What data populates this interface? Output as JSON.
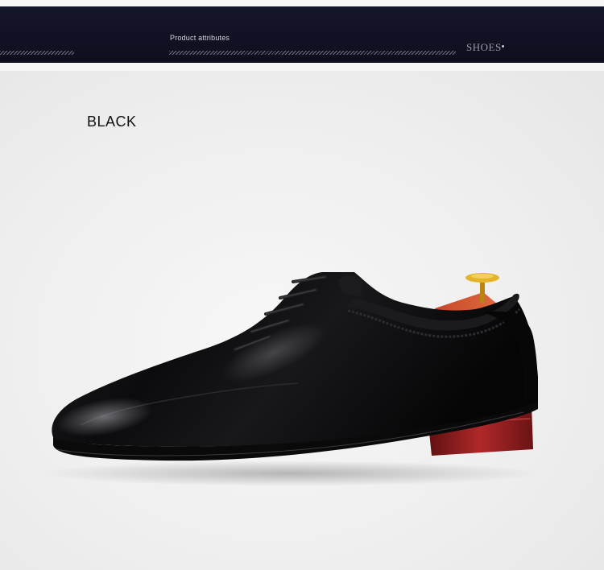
{
  "banner": {
    "title": "Product attributes",
    "category": "SHOES"
  },
  "product": {
    "color_label": "BLACK"
  },
  "colors": {
    "banner": "#0d0e1e",
    "background": "#f1f1f1",
    "leather": "#0b0b0d",
    "heel_accent": "#9a1d1e",
    "shoe_tree_brass": "#d9a520"
  }
}
